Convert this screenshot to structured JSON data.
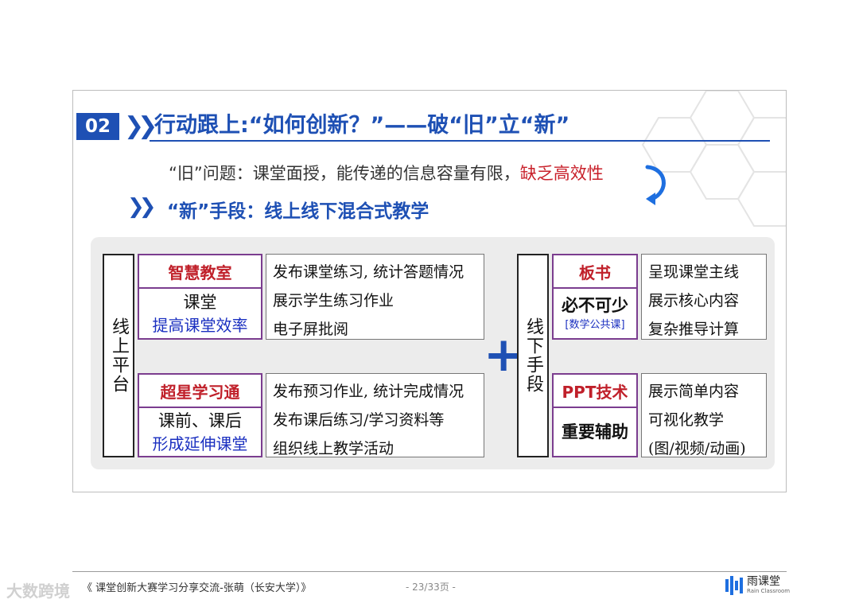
{
  "slide": {
    "section_number": "02",
    "title": "行动跟上:“如何创新？”——破“旧”立“新”",
    "old_problem": {
      "text": "“旧”问题：课堂面授，能传递的信息容量有限，",
      "highlight": "缺乏高效性"
    },
    "new_means": "“新”手段：线上线下混合式教学",
    "online": {
      "label": "线上平台",
      "groups": [
        {
          "name": "智慧教室",
          "line1": "课堂",
          "line2": "提高课堂效率",
          "items": [
            "发布课堂练习, 统计答题情况",
            "展示学生练习作业",
            "电子屏批阅"
          ]
        },
        {
          "name": "超星学习通",
          "line1": "课前、课后",
          "line2": "形成延伸课堂",
          "items": [
            "发布预习作业, 统计完成情况",
            "发布课后练习/学习资料等",
            "组织线上教学活动"
          ]
        }
      ]
    },
    "plus_symbol": "+",
    "offline": {
      "label": "线下手段",
      "groups": [
        {
          "name": "板书",
          "line1": "必不可少",
          "line2": "[数学公共课]",
          "items": [
            "呈现课堂主线",
            "展示核心内容",
            "复杂推导计算"
          ]
        },
        {
          "name": "PPT技术",
          "line1": "重要辅助",
          "items": [
            "展示简单内容",
            "可视化教学",
            "(图/视频/动画)"
          ]
        }
      ]
    }
  },
  "footer": {
    "left_text": "《 课堂创新大赛学习分享交流-张萌（长安大学）》",
    "page_indicator": "- 23/33页 -",
    "logo_name": "雨课堂",
    "logo_sub": "Rain Classroom",
    "watermark": "大数跨境"
  },
  "colors": {
    "primary_blue": "#1e50b4",
    "highlight_red": "#c8202a",
    "box_border_purple": "#7b3d8f",
    "panel_gray": "#ececec"
  }
}
